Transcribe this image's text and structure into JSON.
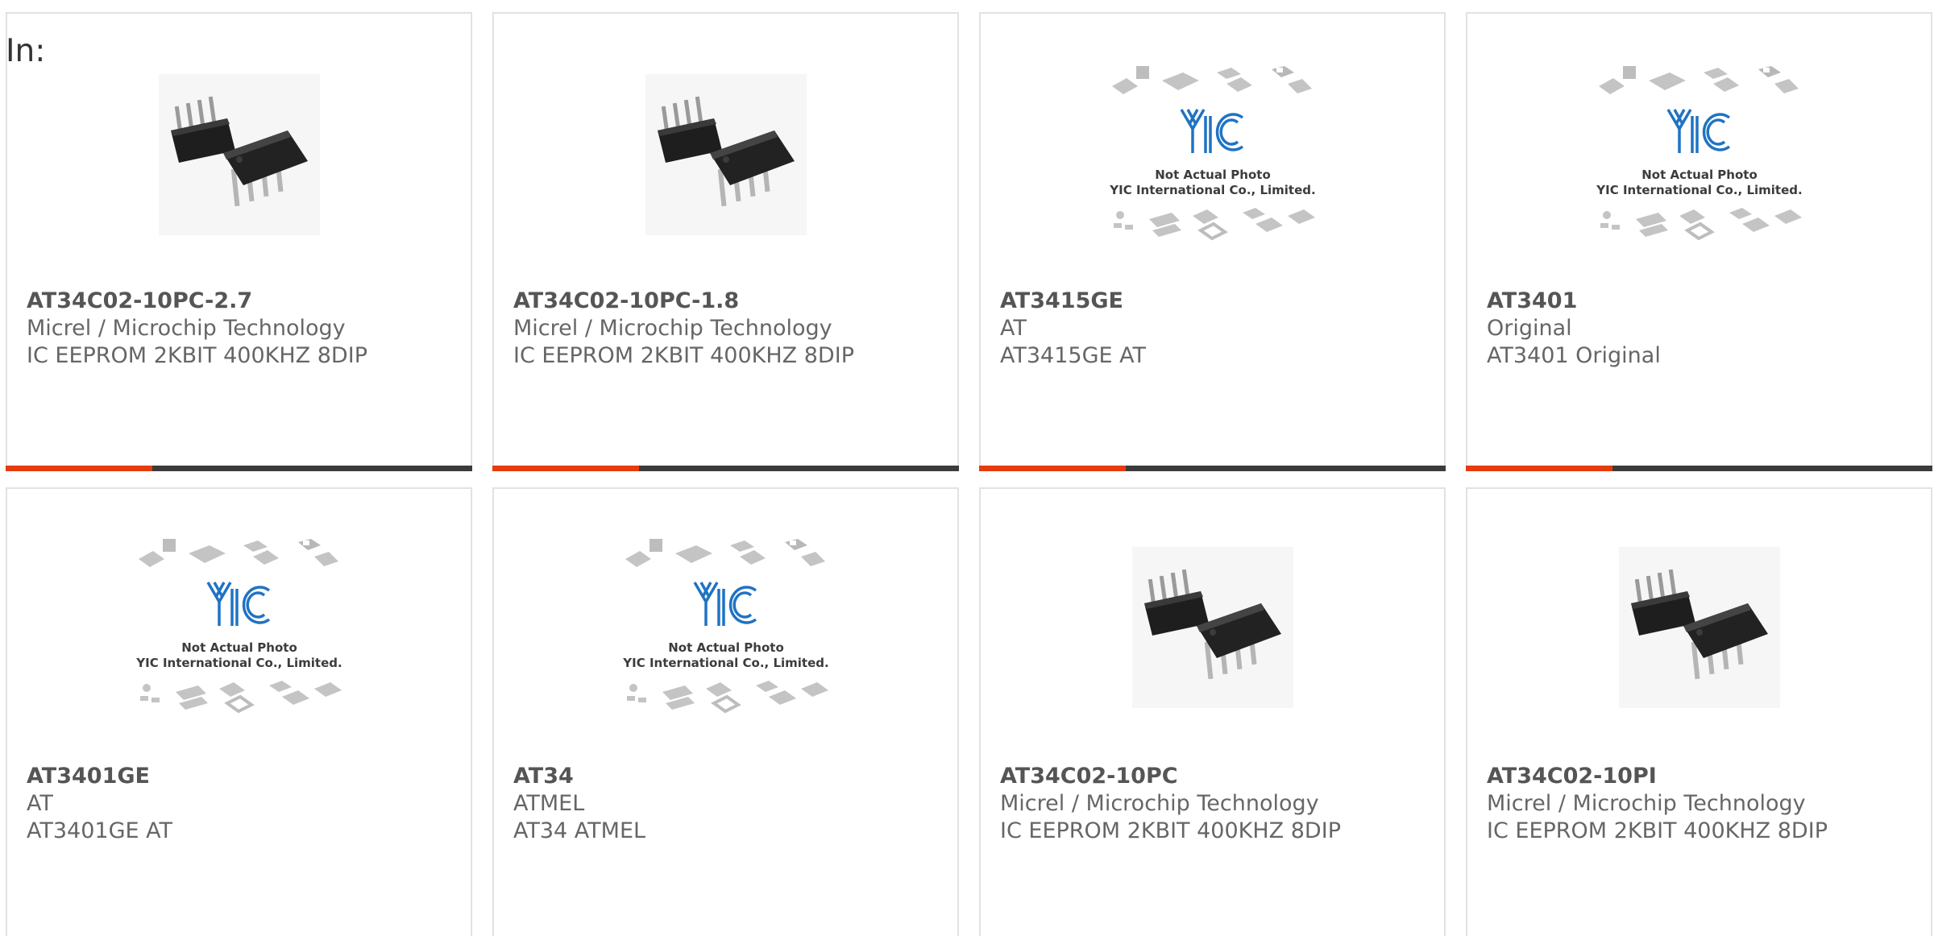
{
  "page": {
    "in_label": "In:"
  },
  "placeholder_text": {
    "line1": "Not Actual Photo",
    "line2": "YIC International Co., Limited."
  },
  "accent_color": "#e53c0e",
  "bar_color": "#3b3b3b",
  "logo_color": "#1f73c4",
  "products": [
    {
      "part": "AT34C02-10PC-2.7",
      "manufacturer": "Micrel / Microchip Technology",
      "description": "IC EEPROM 2KBIT 400KHZ 8DIP",
      "image": "dip8-chip-photo"
    },
    {
      "part": "AT34C02-10PC-1.8",
      "manufacturer": "Micrel / Microchip Technology",
      "description": "IC EEPROM 2KBIT 400KHZ 8DIP",
      "image": "dip8-chip-photo"
    },
    {
      "part": "AT3415GE",
      "manufacturer": "AT",
      "description": "AT3415GE AT",
      "image": "yic-placeholder"
    },
    {
      "part": "AT3401",
      "manufacturer": "Original",
      "description": "AT3401 Original",
      "image": "yic-placeholder"
    },
    {
      "part": "AT3401GE",
      "manufacturer": "AT",
      "description": "AT3401GE AT",
      "image": "yic-placeholder"
    },
    {
      "part": "AT34",
      "manufacturer": "ATMEL",
      "description": "AT34 ATMEL",
      "image": "yic-placeholder"
    },
    {
      "part": "AT34C02-10PC",
      "manufacturer": "Micrel / Microchip Technology",
      "description": "IC EEPROM 2KBIT 400KHZ 8DIP",
      "image": "dip8-chip-photo"
    },
    {
      "part": "AT34C02-10PI",
      "manufacturer": "Micrel / Microchip Technology",
      "description": "IC EEPROM 2KBIT 400KHZ 8DIP",
      "image": "dip8-chip-photo"
    }
  ]
}
